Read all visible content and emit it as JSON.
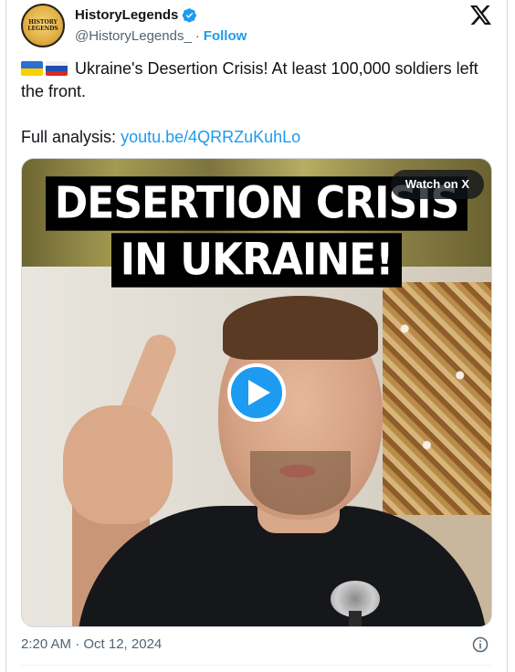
{
  "author": {
    "display_name": "HistoryLegends",
    "handle": "@HistoryLegends_",
    "separator": "·",
    "follow_label": "Follow",
    "avatar_text": "HISTORY LEGENDS",
    "verified": true
  },
  "tweet": {
    "text_line": "Ukraine's Desertion Crisis! At least 100,000 soldiers left the front.",
    "analysis_label": "Full analysis:",
    "analysis_link": "youtu.be/4QRRZuKuhLo",
    "flags": [
      "ukraine-flag",
      "russia-flag"
    ]
  },
  "media": {
    "headline_line1": "DESERTION CRISIS",
    "headline_line2": "IN UKRAINE!",
    "watch_label": "Watch on X",
    "play_icon": "play-icon"
  },
  "footer": {
    "timestamp": "2:20 AM · Oct 12, 2024",
    "info_icon": "info-icon"
  },
  "colors": {
    "accent": "#1d9bf0",
    "text_primary": "#0f1419",
    "text_secondary": "#536471"
  }
}
